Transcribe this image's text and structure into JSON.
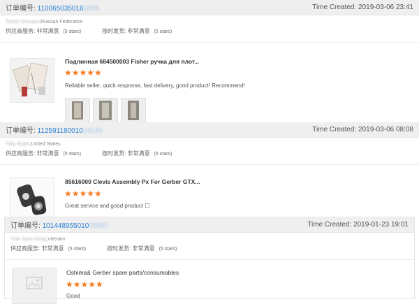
{
  "orders": [
    {
      "label": "订单编号:",
      "id_visible": "110065035016",
      "id_blurred": "3385",
      "time": "Time Created: 2019-03-06 23:41",
      "buyer_blurred": "Tsetsil Shuvaev",
      "buyer_country": ",Russian Federation",
      "service_label": "供应商服务: 非常满意",
      "service_stars": "(5 stars)",
      "delivery_label": "按时发货: 非常满意",
      "delivery_stars": "(5 stars)",
      "product_title": "Подлинная 684500003 Fisher ручка для плот...",
      "rating": "★★★★★",
      "review": "Reliable seller, quick response, fast delivery, good product! Recommend!"
    },
    {
      "label": "订单编号:",
      "id_visible": "112591180010",
      "id_blurred": "24149",
      "time": "Time Created: 2019-03-06 08:08",
      "buyer_blurred": "Toby Butler",
      "buyer_country": ",United States",
      "service_label": "供应商服务: 非常满意",
      "service_stars": "(5 stars)",
      "delivery_label": "按时发货: 非常满意",
      "delivery_stars": "(5 stars)",
      "product_title": "85616000 Clevis Assembly Px For Gerber GTX...",
      "rating": "★★★★★",
      "review": "Great service and good product ☐"
    },
    {
      "label": "订单编号:",
      "id_visible": "101448955010",
      "id_blurred": "03697",
      "time": "Time Created: 2019-01-23 19:01",
      "buyer_blurred": "Tran Xuan Hung",
      "buyer_country": ",Vietnam",
      "service_label": "供应商服务: 非常满意",
      "service_stars": "(5 stars)",
      "delivery_label": "按时发货: 非常满意",
      "delivery_stars": "(5 stars)",
      "product_title": "Oshima& Gerber spare parts/consumables",
      "rating": "★★★★★",
      "review": "Good"
    }
  ],
  "colors": {
    "accent": "#2a7fd4",
    "star": "#f47b20",
    "header_bg": "#efefef"
  }
}
